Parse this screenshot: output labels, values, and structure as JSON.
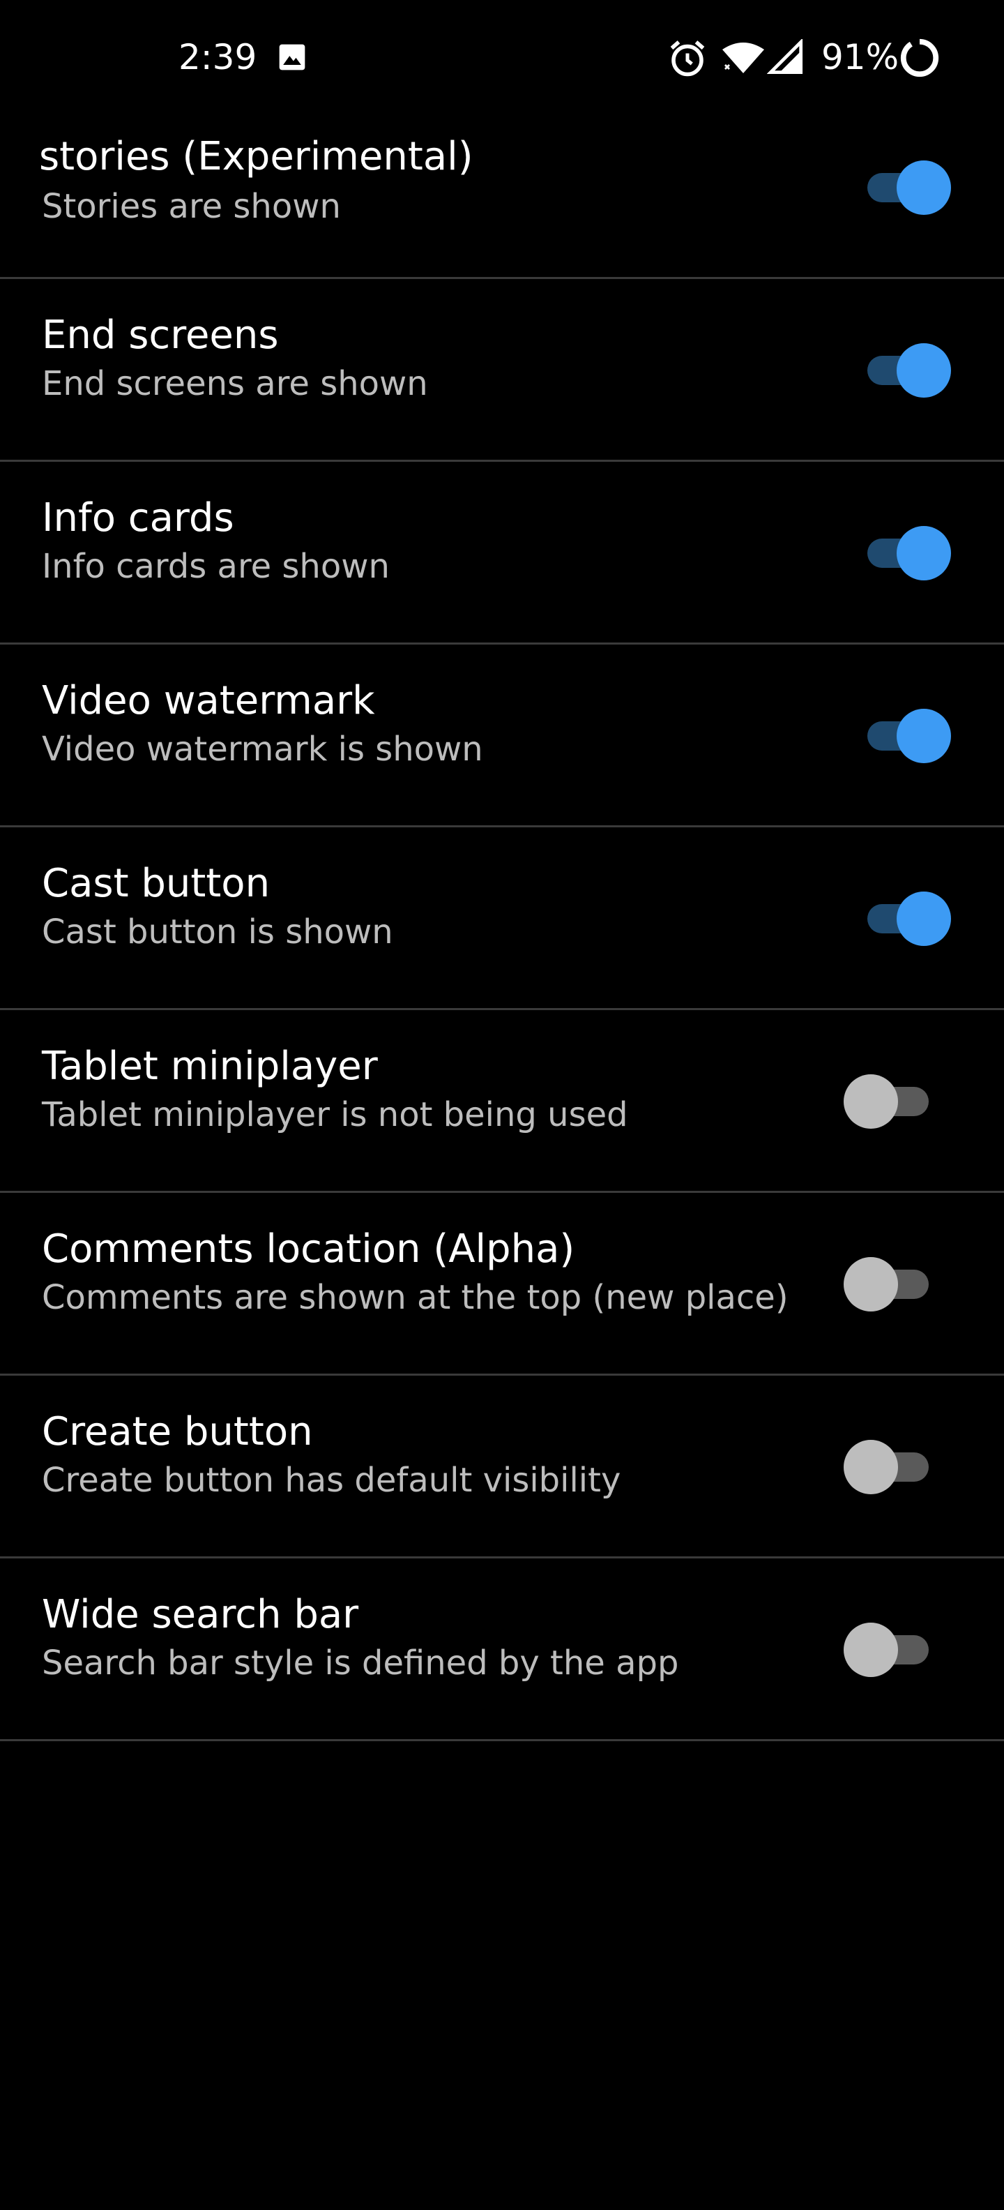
{
  "status_bar": {
    "time": "2:39",
    "battery_percent": "91%",
    "icons": [
      "gallery-icon",
      "alarm-icon",
      "wifi-icon",
      "signal-icon",
      "battery-ring-icon"
    ]
  },
  "colors": {
    "background": "#000000",
    "divider": "#3a3a3a",
    "accent": "#3d9bf4",
    "toggle_on_track": "#1f4a6f",
    "toggle_off_thumb": "#bdbdbd",
    "toggle_off_track": "#5a5a5a",
    "summary_text": "#bdbdbd"
  },
  "settings": [
    {
      "title": "stories (Experimental)",
      "summary": "Stories are shown",
      "enabled": true
    },
    {
      "title": "End screens",
      "summary": "End screens are shown",
      "enabled": true
    },
    {
      "title": "Info cards",
      "summary": "Info cards are shown",
      "enabled": true
    },
    {
      "title": "Video watermark",
      "summary": "Video watermark is shown",
      "enabled": true
    },
    {
      "title": "Cast button",
      "summary": "Cast button is shown",
      "enabled": true
    },
    {
      "title": "Tablet miniplayer",
      "summary": "Tablet miniplayer is not being used",
      "enabled": false
    },
    {
      "title": "Comments location (Alpha)",
      "summary": "Comments are shown at the top (new place)",
      "enabled": false
    },
    {
      "title": "Create button",
      "summary": "Create button has default visibility",
      "enabled": false
    },
    {
      "title": "Wide search bar",
      "summary": "Search bar style is defined by the app",
      "enabled": false
    }
  ]
}
